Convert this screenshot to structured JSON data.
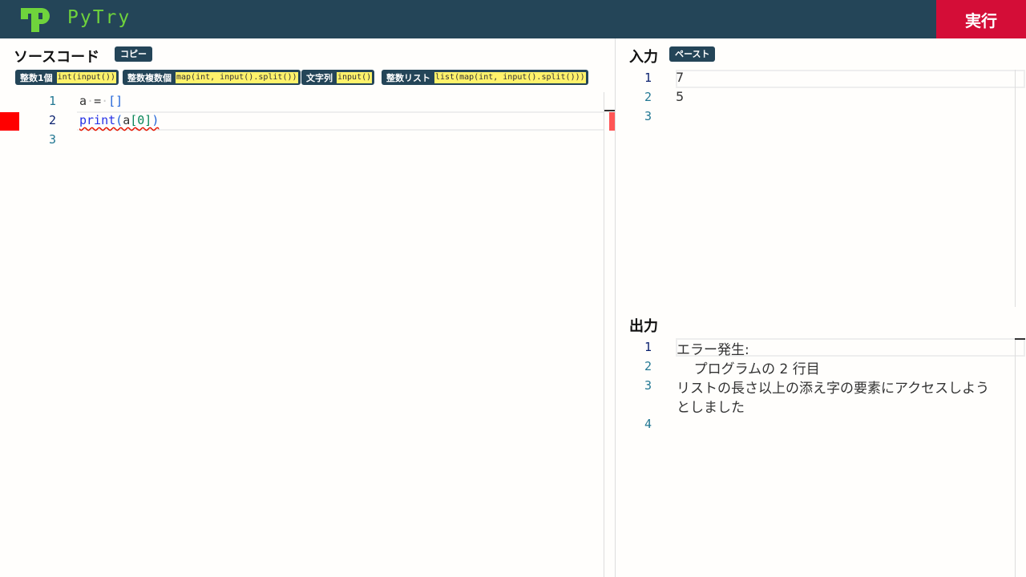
{
  "header": {
    "brand": "PyTry",
    "run_label": "実行",
    "colors": {
      "bar": "#244558",
      "brand": "#6fd33c",
      "run": "#d40d37"
    }
  },
  "source": {
    "title": "ソースコード",
    "copy_label": "コピー",
    "snippets": [
      {
        "label": "整数1個",
        "code": "int(input())"
      },
      {
        "label": "整数複数個",
        "code": "map(int, input().split())"
      },
      {
        "label": "文字列",
        "code": "input()"
      },
      {
        "label": "整数リスト",
        "code": "list(map(int, input().split()))"
      }
    ],
    "line_numbers": [
      "1",
      "2",
      "3"
    ],
    "error_line": 2
  },
  "input": {
    "title": "入力",
    "paste_label": "ペースト",
    "line_numbers": [
      "1",
      "2",
      "3"
    ],
    "lines": [
      "7",
      "5",
      ""
    ]
  },
  "output": {
    "title": "出力",
    "line_numbers": [
      "1",
      "2",
      "3",
      "4"
    ],
    "lines": [
      "エラー発生:",
      "    プログラムの 2 行目",
      "リストの長さ以上の添え字の要素にアクセスしよう",
      "としました"
    ]
  }
}
